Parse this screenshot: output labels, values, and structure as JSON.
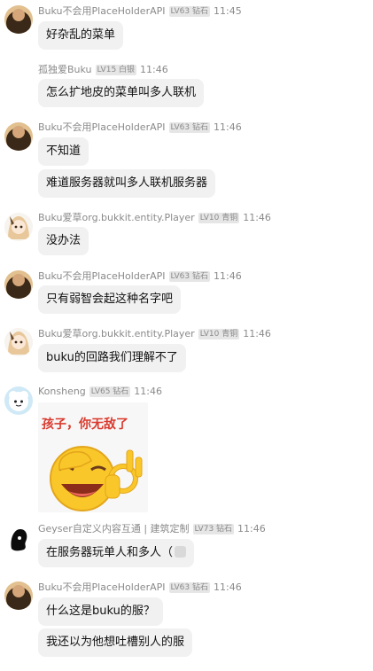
{
  "messages": [
    {
      "sender": "Buku不会用PlaceHolderAPI",
      "badge": "LV63 钻石",
      "time": "11:45",
      "lines": [
        "好杂乱的菜单"
      ]
    },
    {
      "sender": "孤独爱Buku",
      "badge": "LV15 白银",
      "time": "11:46",
      "lines": [
        "怎么扩地皮的菜单叫多人联机"
      ]
    },
    {
      "sender": "Buku不会用PlaceHolderAPI",
      "badge": "LV63 钻石",
      "time": "11:46",
      "lines": [
        "不知道",
        "难道服务器就叫多人联机服务器"
      ]
    },
    {
      "sender": "Buku爱草org.bukkit.entity.Player",
      "badge": "LV10 青铜",
      "time": "11:46",
      "lines": [
        "没办法"
      ]
    },
    {
      "sender": "Buku不会用PlaceHolderAPI",
      "badge": "LV63 钻石",
      "time": "11:46",
      "lines": [
        "只有弱智会起这种名字吧"
      ]
    },
    {
      "sender": "Buku爱草org.bukkit.entity.Player",
      "badge": "LV10 青铜",
      "time": "11:46",
      "lines": [
        "buku的回路我们理解不了"
      ]
    },
    {
      "sender": "Konsheng",
      "badge": "LV65 钻石",
      "time": "11:46",
      "sticker_text": "孩子，你无敌了"
    },
    {
      "sender": "Geyser自定义内容互通 | 建筑定制",
      "badge": "LV73 钻石",
      "time": "11:46",
      "lines": [
        "在服务器玩单人和多人（"
      ]
    },
    {
      "sender": "Buku不会用PlaceHolderAPI",
      "badge": "LV63 钻石",
      "time": "11:46",
      "lines": [
        "什么这是buku的服？",
        "我还以为他想吐槽别人的服"
      ]
    }
  ],
  "colors": {
    "bubble": "#f1f1f1",
    "meta_text": "#8a8a8a",
    "badge_bg": "#e6e6e6",
    "sticker_text": "#d93a2e"
  }
}
